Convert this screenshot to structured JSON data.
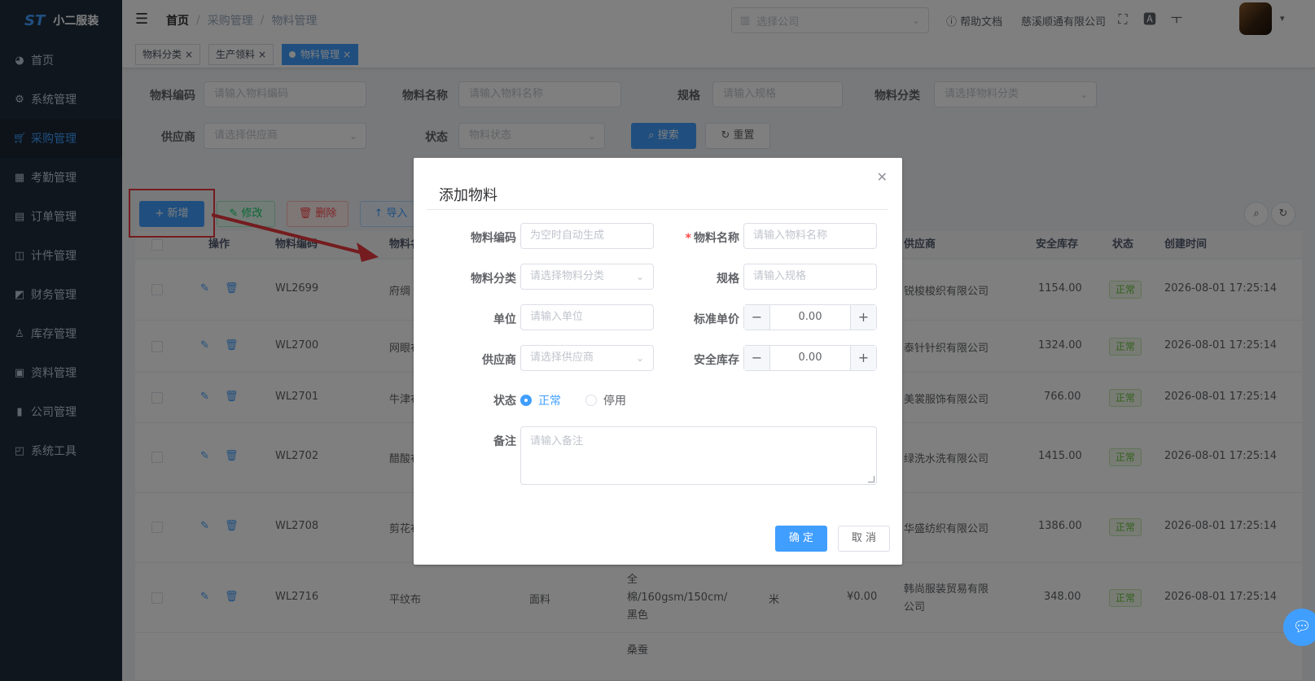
{
  "app": {
    "logo_text": "小二服装",
    "logo_mark": "ST"
  },
  "sidebar": {
    "items": [
      {
        "label": "首页",
        "icon": "dashboard-icon"
      },
      {
        "label": "系统管理",
        "icon": "gear-icon"
      },
      {
        "label": "采购管理",
        "icon": "cart-icon",
        "active": true
      },
      {
        "label": "考勤管理",
        "icon": "grid-icon"
      },
      {
        "label": "订单管理",
        "icon": "order-icon"
      },
      {
        "label": "计件管理",
        "icon": "book-icon"
      },
      {
        "label": "财务管理",
        "icon": "finance-icon"
      },
      {
        "label": "库存管理",
        "icon": "user-icon"
      },
      {
        "label": "资料管理",
        "icon": "document-icon"
      },
      {
        "label": "公司管理",
        "icon": "chart-icon"
      },
      {
        "label": "系统工具",
        "icon": "toolbox-icon"
      }
    ]
  },
  "navbar": {
    "breadcrumb": [
      "首页",
      "采购管理",
      "物料管理"
    ],
    "company_placeholder": "选择公司",
    "help_label": "帮助文档",
    "company_name": "慈溪顺通有限公司"
  },
  "tags": [
    {
      "label": "物料分类"
    },
    {
      "label": "生产领料"
    },
    {
      "label": "物料管理",
      "active": true
    }
  ],
  "search": {
    "code_label": "物料编码",
    "code_placeholder": "请输入物料编码",
    "name_label": "物料名称",
    "name_placeholder": "请输入物料名称",
    "spec_label": "规格",
    "spec_placeholder": "请输入规格",
    "category_label": "物料分类",
    "category_placeholder": "请选择物料分类",
    "supplier_label": "供应商",
    "supplier_placeholder": "请选择供应商",
    "status_label": "状态",
    "status_placeholder": "物料状态",
    "search_btn": "搜索",
    "reset_btn": "重置"
  },
  "toolbar": {
    "add": "新增",
    "edit": "修改",
    "delete": "删除",
    "import": "导入"
  },
  "table": {
    "headers": {
      "op": "操作",
      "code": "物料编码",
      "name": "物料名称",
      "supplier": "供应商",
      "stock": "安全库存",
      "status": "状态",
      "created": "创建时间"
    },
    "rows": [
      {
        "code": "WL2699",
        "name": "府绸",
        "category": "",
        "spec": "",
        "unit": "",
        "price": "",
        "supplier": "锐梭梭织有限公司",
        "stock": "1154.00",
        "status": "正常",
        "created": "2026-08-01 17:25:14"
      },
      {
        "code": "WL2700",
        "name": "网眼布",
        "category": "",
        "spec": "",
        "unit": "",
        "price": "",
        "supplier": "泰针针织有限公司",
        "stock": "1324.00",
        "status": "正常",
        "created": "2026-08-01 17:25:14"
      },
      {
        "code": "WL2701",
        "name": "牛津布",
        "category": "",
        "spec": "",
        "unit": "",
        "price": "",
        "supplier": "美裳服饰有限公司",
        "stock": "766.00",
        "status": "正常",
        "created": "2026-08-01 17:25:14"
      },
      {
        "code": "WL2702",
        "name": "醋酸布",
        "category": "",
        "spec": "",
        "unit": "",
        "price": "",
        "supplier": "绿洗水洗有限公司",
        "stock": "1415.00",
        "status": "正常",
        "created": "2026-08-01 17:25:14"
      },
      {
        "code": "WL2708",
        "name": "剪花布",
        "category": "",
        "spec": "",
        "unit": "",
        "price": "",
        "supplier": "华盛纺织有限公司",
        "stock": "1386.00",
        "status": "正常",
        "created": "2026-08-01 17:25:14"
      },
      {
        "code": "WL2716",
        "name": "平纹布",
        "category": "面料",
        "spec": "全\n棉/160gsm/150cm/\n黑色",
        "unit": "米",
        "price": "¥0.00",
        "supplier": "韩尚服装贸易有限\n公司",
        "stock": "348.00",
        "status": "正常",
        "created": "2026-08-01 17:25:14"
      },
      {
        "code": "",
        "name": "",
        "category": "",
        "spec": "桑蚕",
        "unit": "",
        "price": "",
        "supplier": "",
        "stock": "",
        "status": "",
        "created": ""
      }
    ]
  },
  "dialog": {
    "title": "添加物料",
    "code_label": "物料编码",
    "code_placeholder": "为空时自动生成",
    "name_label": "物料名称",
    "name_placeholder": "请输入物料名称",
    "category_label": "物料分类",
    "category_placeholder": "请选择物料分类",
    "spec_label": "规格",
    "spec_placeholder": "请输入规格",
    "unit_label": "单位",
    "unit_placeholder": "请输入单位",
    "price_label": "标准单价",
    "price_value": "0.00",
    "supplier_label": "供应商",
    "supplier_placeholder": "请选择供应商",
    "stock_label": "安全库存",
    "stock_value": "0.00",
    "status_label": "状态",
    "status_on": "正常",
    "status_off": "停用",
    "remark_label": "备注",
    "remark_placeholder": "请输入备注",
    "ok": "确 定",
    "cancel": "取 消"
  },
  "colors": {
    "primary": "#409eff",
    "sidebar_bg": "#1f2d3d",
    "highlight": "#e8393e",
    "success": "#67c23a"
  }
}
